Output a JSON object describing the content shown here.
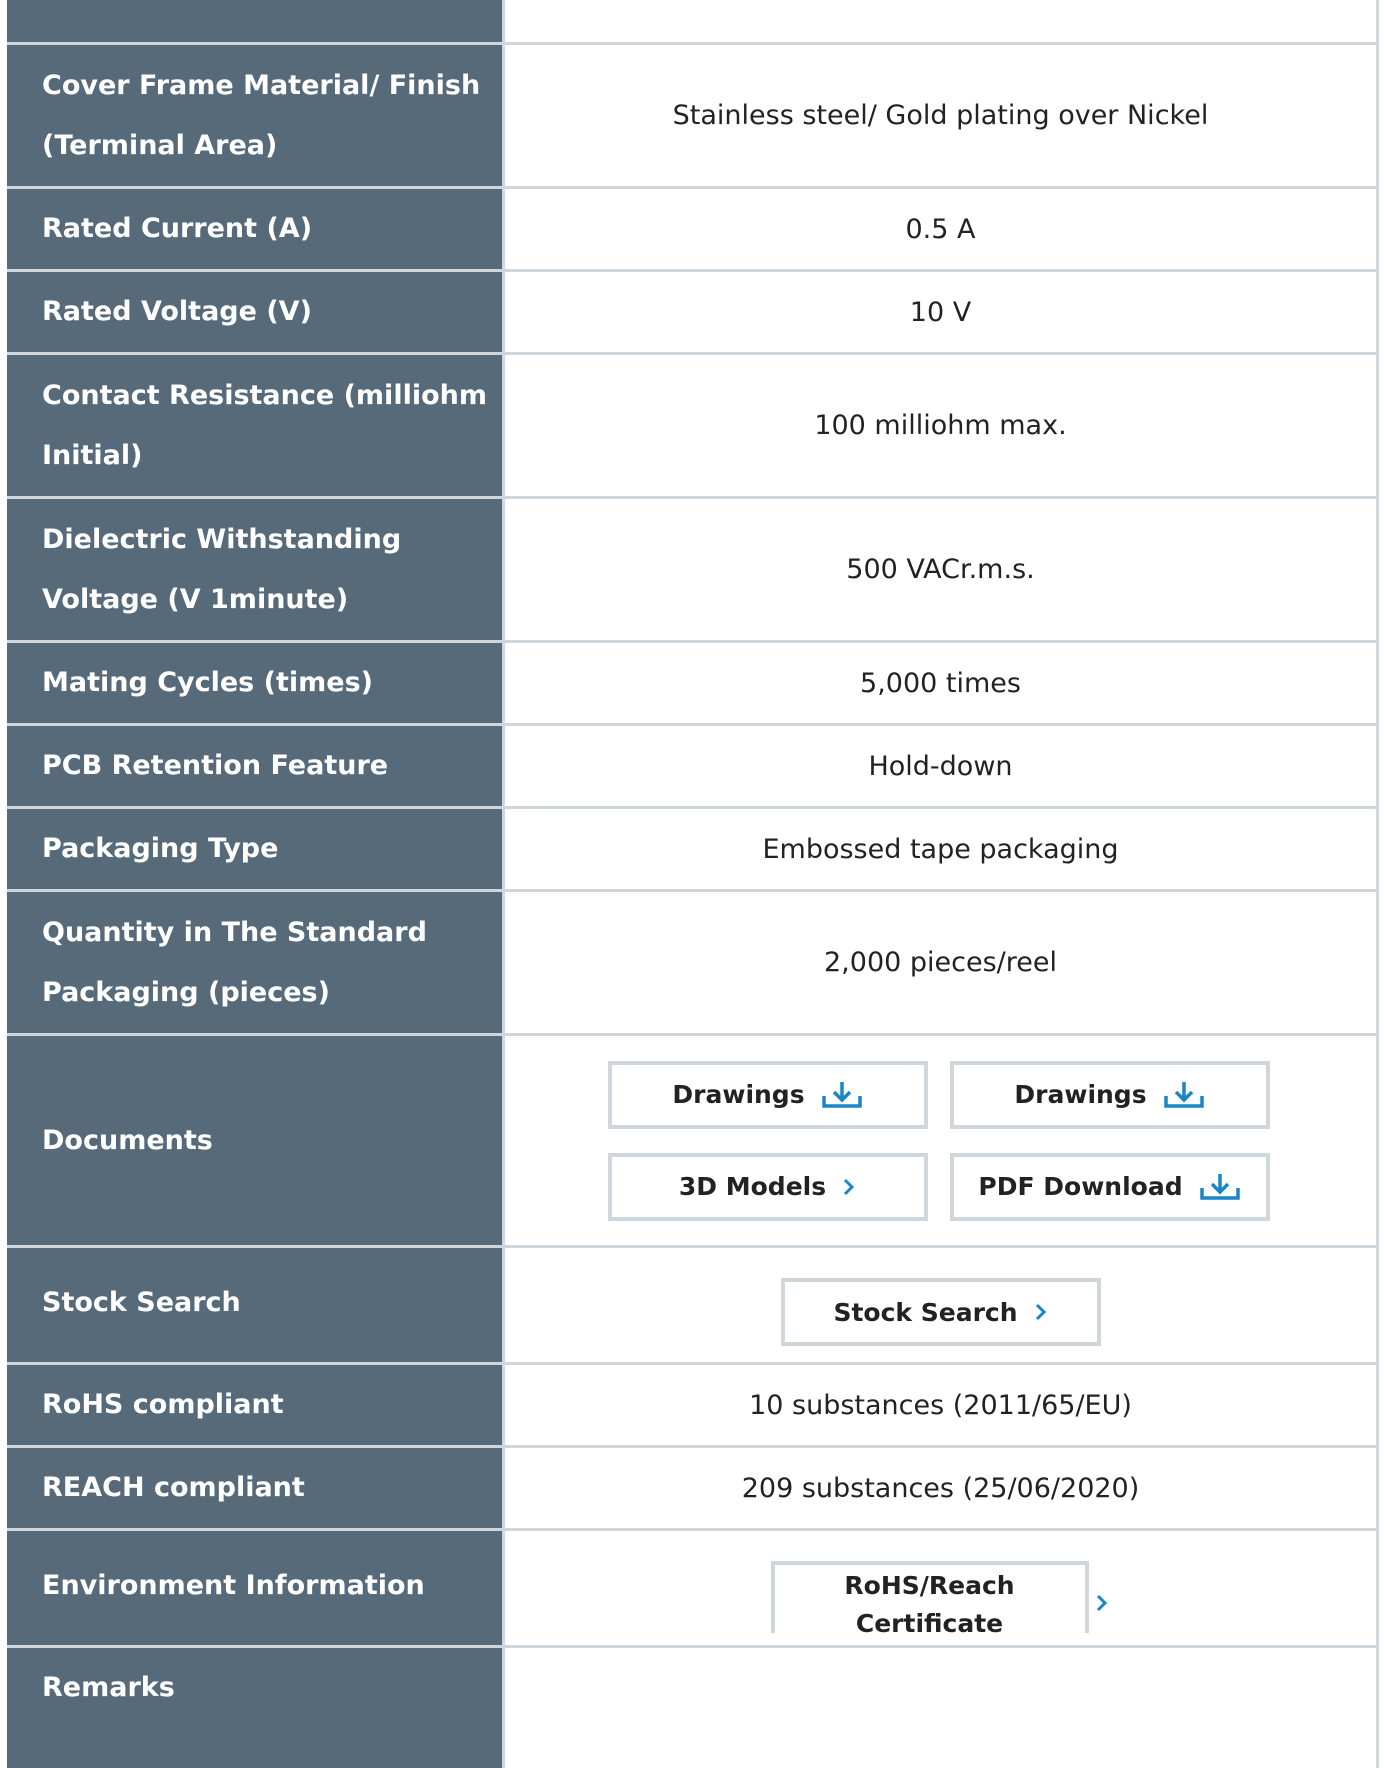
{
  "colors": {
    "label_bg": "#566a79",
    "border": "#cfd6dc",
    "accent": "#1a86c8"
  },
  "table": {
    "rows": [
      {
        "label": "",
        "value": ""
      },
      {
        "label": "Cover Frame Material/ Finish (Terminal Area)",
        "value": "Stainless steel/ Gold plating over Nickel"
      },
      {
        "label": "Rated Current (A)",
        "value": "0.5 A"
      },
      {
        "label": "Rated Voltage (V)",
        "value": "10 V"
      },
      {
        "label": "Contact Resistance (milliohm Initial)",
        "value": "100 milliohm max."
      },
      {
        "label": "Dielectric Withstanding Voltage (V 1minute)",
        "value": "500 VACr.m.s."
      },
      {
        "label": "Mating Cycles (times)",
        "value": "5,000 times"
      },
      {
        "label": "PCB Retention Feature",
        "value": "Hold-down"
      },
      {
        "label": "Packaging Type",
        "value": "Embossed tape packaging"
      },
      {
        "label": "Quantity in The Standard Packaging (pieces)",
        "value": "2,000 pieces/reel"
      }
    ],
    "documents": {
      "label": "Documents",
      "buttons": [
        {
          "label": "Drawings",
          "icon": "download-icon"
        },
        {
          "label": "Drawings",
          "icon": "download-icon"
        },
        {
          "label": "3D Models",
          "icon": "chevron-right-icon"
        },
        {
          "label": "PDF Download",
          "icon": "download-icon"
        }
      ]
    },
    "stock": {
      "label": "Stock Search",
      "button": "Stock Search"
    },
    "rohs": {
      "label": "RoHS compliant",
      "value": "10 substances (2011/65/EU)"
    },
    "reach": {
      "label": "REACH compliant",
      "value": "209 substances (25/06/2020)"
    },
    "environment": {
      "label": "Environment Information",
      "button_line1": "RoHS/Reach",
      "button_line2": "Certificate"
    },
    "remarks": {
      "label": "Remarks",
      "value": ""
    }
  }
}
